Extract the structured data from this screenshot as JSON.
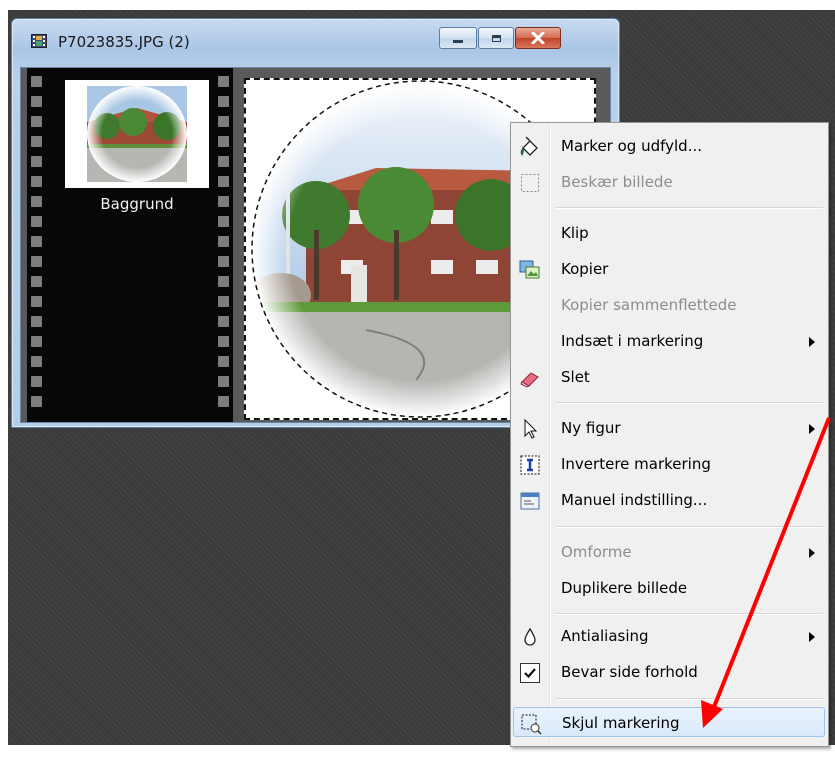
{
  "window": {
    "title": "P7023835.JPG (2)",
    "controls": {
      "minimize": "minimize-icon",
      "maximize": "maximize-icon",
      "close": "close-icon"
    }
  },
  "layers": [
    {
      "label": "Baggrund"
    }
  ],
  "context_menu": {
    "items": [
      {
        "id": "marker-og-udfyld",
        "label": "Marker og udfyld...",
        "icon": "paint-bucket-icon",
        "enabled": true
      },
      {
        "id": "beskaer-billede",
        "label": "Beskær billede",
        "icon": "crop-icon",
        "enabled": false
      },
      {
        "id": "klip",
        "label": "Klip",
        "enabled": true
      },
      {
        "id": "kopier",
        "label": "Kopier",
        "icon": "copy-picture-icon",
        "enabled": true
      },
      {
        "id": "kopier-sammenflettede",
        "label": "Kopier sammenflettede",
        "enabled": false
      },
      {
        "id": "indsaet-i-markering",
        "label": "Indsæt i markering",
        "enabled": true,
        "submenu": true
      },
      {
        "id": "slet",
        "label": "Slet",
        "icon": "eraser-icon",
        "enabled": true
      },
      {
        "id": "ny-figur",
        "label": "Ny figur",
        "icon": "pointer-icon",
        "enabled": true,
        "submenu": true
      },
      {
        "id": "invertere-markering",
        "label": "Invertere markering",
        "icon": "invert-selection-icon",
        "enabled": true
      },
      {
        "id": "manuel-indstilling",
        "label": "Manuel indstilling...",
        "icon": "settings-window-icon",
        "enabled": true
      },
      {
        "id": "omforme",
        "label": "Omforme",
        "enabled": false,
        "submenu": true
      },
      {
        "id": "duplikere-billede",
        "label": "Duplikere billede",
        "enabled": true
      },
      {
        "id": "antialiasing",
        "label": "Antialiasing",
        "icon": "drop-icon",
        "enabled": true,
        "submenu": true
      },
      {
        "id": "bevar-side-forhold",
        "label": "Bevar side forhold",
        "icon": "checkmark-icon",
        "enabled": true,
        "checked": true
      },
      {
        "id": "skjul-markering",
        "label": "Skjul markering",
        "icon": "hide-selection-icon",
        "enabled": true,
        "highlighted": true
      }
    ]
  },
  "colors": {
    "annotation_arrow": "#ff0000",
    "highlight": "#d9e9fb"
  }
}
